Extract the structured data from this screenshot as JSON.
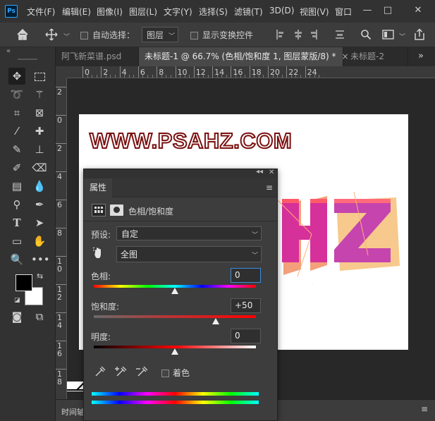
{
  "app": {
    "logo": "Ps"
  },
  "menu": [
    "文件(F)",
    "编辑(E)",
    "图像(I)",
    "图层(L)",
    "文字(Y)",
    "选择(S)",
    "滤镜(T)",
    "3D(D)",
    "视图(V)",
    "窗口"
  ],
  "window_controls": {
    "minimize": "—",
    "maximize": "□",
    "close": "✕"
  },
  "options": {
    "auto_select_label": "自动选择：",
    "auto_select_value": "图层",
    "show_transform_label": "显示变换控件"
  },
  "tabs": [
    {
      "label": "阿飞新菜谱.psd",
      "active": false
    },
    {
      "label": "未标题-1 @ 66.7% (色相/饱和度 1, 图层蒙版/8) *",
      "active": true
    },
    {
      "label": "未标题-2",
      "active": false
    }
  ],
  "ruler": {
    "h_labels": [
      "0",
      "2",
      "4",
      "6",
      "8",
      "10",
      "12",
      "14",
      "16",
      "18",
      "20",
      "22",
      "24"
    ],
    "v_labels": [
      "2",
      "0",
      "2",
      "4",
      "6",
      "8",
      "1\n0",
      "1\n2",
      "1\n4",
      "1\n6",
      "1\n8"
    ]
  },
  "canvas": {
    "watermark": "WWW.PSAHZ.COM",
    "art_text": "HZ"
  },
  "properties": {
    "tab_label": "属性",
    "adjustment_title": "色相/饱和度",
    "preset_label": "预设:",
    "preset_value": "自定",
    "channel_value": "全图",
    "hue_label": "色相:",
    "hue_value": "0",
    "saturation_label": "饱和度:",
    "saturation_value": "+50",
    "lightness_label": "明度:",
    "lightness_value": "0",
    "colorize_label": "着色",
    "slider_levels": {
      "hue": 0,
      "saturation": 50,
      "lightness": 0
    }
  },
  "bottom": {
    "timeline_label": "时间轴"
  },
  "colors": {
    "foreground": "#000000",
    "background": "#ffffff",
    "accent": "#31a8ff"
  }
}
